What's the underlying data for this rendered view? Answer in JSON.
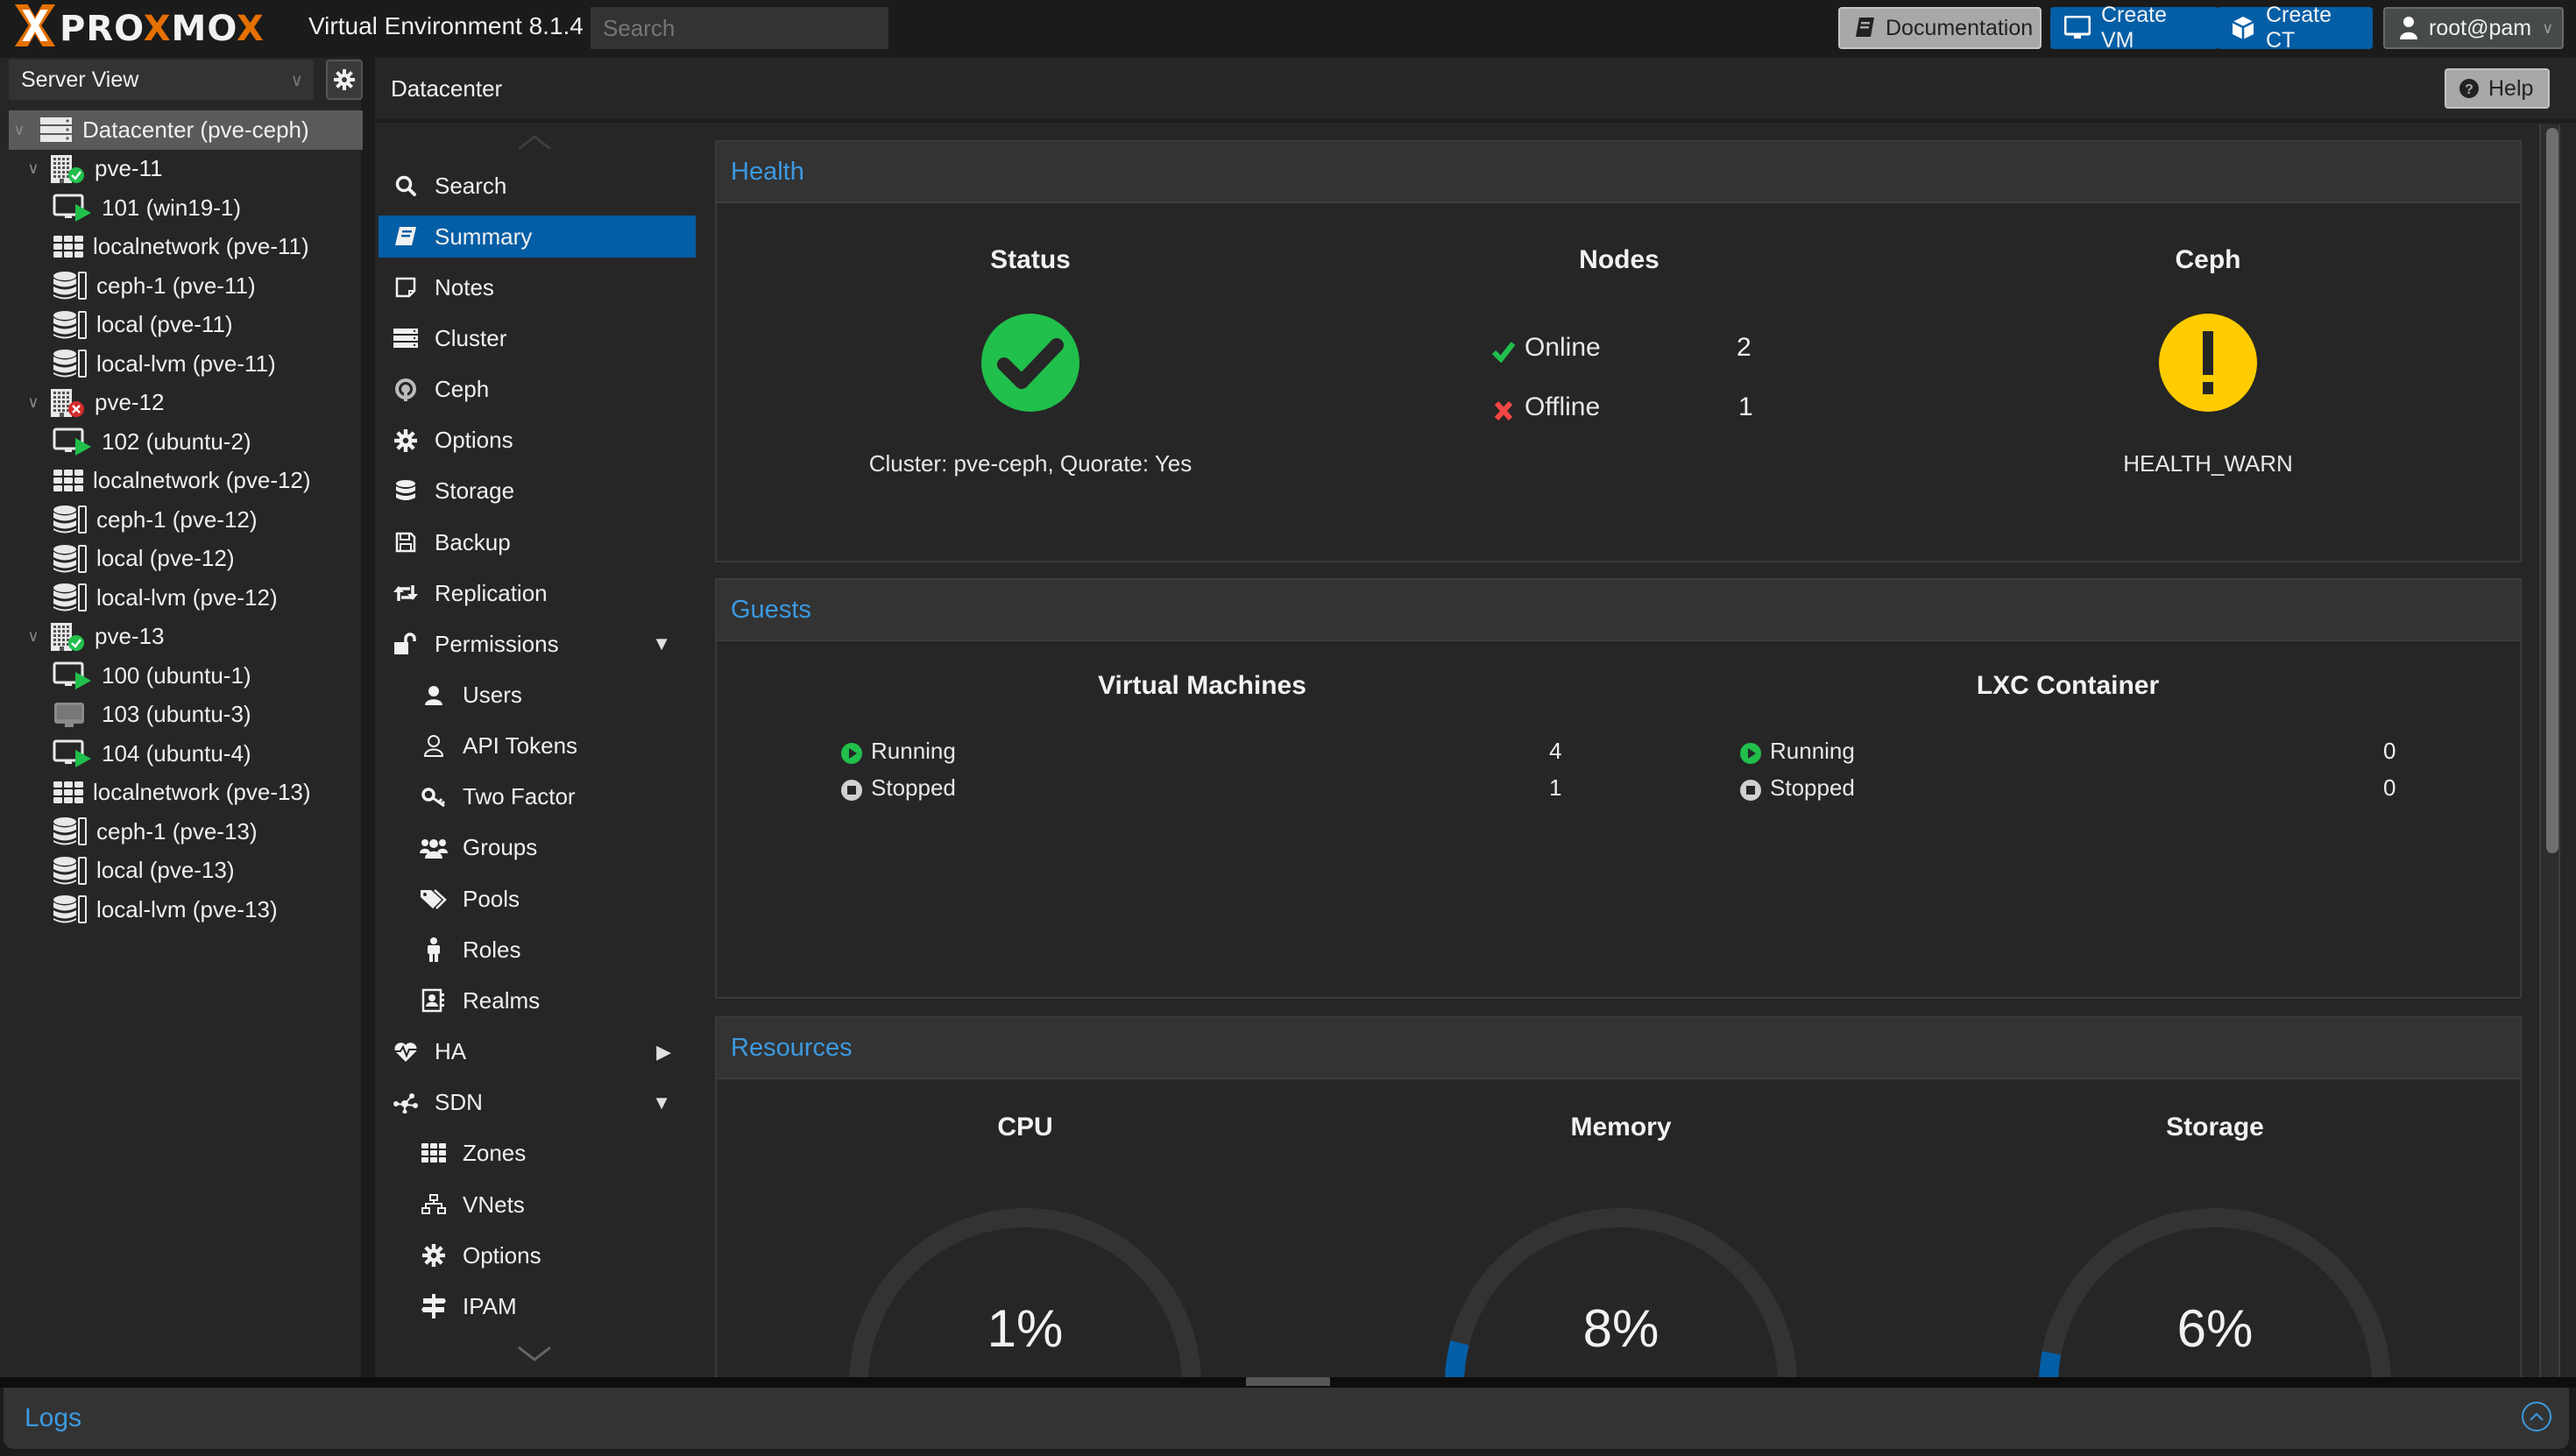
{
  "topbar": {
    "brand": "PROXMOX",
    "product": "Virtual Environment 8.1.4",
    "search_placeholder": "Search",
    "buttons": {
      "documentation": "Documentation",
      "create_vm": "Create VM",
      "create_ct": "Create CT",
      "user": "root@pam"
    }
  },
  "tree": {
    "view": "Server View",
    "nodes": [
      {
        "label": "Datacenter (pve-ceph)",
        "type": "datacenter",
        "level": 0
      },
      {
        "label": "pve-11",
        "type": "node-online",
        "level": 1
      },
      {
        "label": "101 (win19-1)",
        "type": "vm-running",
        "level": 2
      },
      {
        "label": "localnetwork (pve-11)",
        "type": "network",
        "level": 2
      },
      {
        "label": "ceph-1 (pve-11)",
        "type": "storage",
        "level": 2
      },
      {
        "label": "local (pve-11)",
        "type": "storage",
        "level": 2
      },
      {
        "label": "local-lvm (pve-11)",
        "type": "storage",
        "level": 2
      },
      {
        "label": "pve-12",
        "type": "node-offline",
        "level": 1
      },
      {
        "label": "102 (ubuntu-2)",
        "type": "vm-running",
        "level": 2
      },
      {
        "label": "localnetwork (pve-12)",
        "type": "network",
        "level": 2
      },
      {
        "label": "ceph-1 (pve-12)",
        "type": "storage",
        "level": 2
      },
      {
        "label": "local (pve-12)",
        "type": "storage",
        "level": 2
      },
      {
        "label": "local-lvm (pve-12)",
        "type": "storage",
        "level": 2
      },
      {
        "label": "pve-13",
        "type": "node-online",
        "level": 1
      },
      {
        "label": "100 (ubuntu-1)",
        "type": "vm-running",
        "level": 2
      },
      {
        "label": "103 (ubuntu-3)",
        "type": "vm-stopped",
        "level": 2
      },
      {
        "label": "104 (ubuntu-4)",
        "type": "vm-running",
        "level": 2
      },
      {
        "label": "localnetwork (pve-13)",
        "type": "network",
        "level": 2
      },
      {
        "label": "ceph-1 (pve-13)",
        "type": "storage",
        "level": 2
      },
      {
        "label": "local (pve-13)",
        "type": "storage",
        "level": 2
      },
      {
        "label": "local-lvm (pve-13)",
        "type": "storage",
        "level": 2
      }
    ]
  },
  "breadcrumb": "Datacenter",
  "help_label": "Help",
  "nav": {
    "items": [
      {
        "label": "Search",
        "icon": "search-icon",
        "sub": false
      },
      {
        "label": "Summary",
        "icon": "book-icon",
        "sub": false,
        "selected": true
      },
      {
        "label": "Notes",
        "icon": "note-icon",
        "sub": false
      },
      {
        "label": "Cluster",
        "icon": "server-icon",
        "sub": false
      },
      {
        "label": "Ceph",
        "icon": "ceph-icon",
        "sub": false
      },
      {
        "label": "Options",
        "icon": "gear-icon",
        "sub": false
      },
      {
        "label": "Storage",
        "icon": "database-icon",
        "sub": false
      },
      {
        "label": "Backup",
        "icon": "floppy-icon",
        "sub": false
      },
      {
        "label": "Replication",
        "icon": "retweet-icon",
        "sub": false
      },
      {
        "label": "Permissions",
        "icon": "unlock-icon",
        "sub": false,
        "arrow": "down"
      },
      {
        "label": "Users",
        "icon": "user-icon",
        "sub": true
      },
      {
        "label": "API Tokens",
        "icon": "user-outline-icon",
        "sub": true
      },
      {
        "label": "Two Factor",
        "icon": "key-icon",
        "sub": true
      },
      {
        "label": "Groups",
        "icon": "users-icon",
        "sub": true
      },
      {
        "label": "Pools",
        "icon": "tags-icon",
        "sub": true
      },
      {
        "label": "Roles",
        "icon": "male-icon",
        "sub": true
      },
      {
        "label": "Realms",
        "icon": "address-book-icon",
        "sub": true
      },
      {
        "label": "HA",
        "icon": "heartbeat-icon",
        "sub": false,
        "arrow": "right"
      },
      {
        "label": "SDN",
        "icon": "sdn-icon",
        "sub": false,
        "arrow": "down"
      },
      {
        "label": "Zones",
        "icon": "grid-icon",
        "sub": true
      },
      {
        "label": "VNets",
        "icon": "sitemap-icon",
        "sub": true
      },
      {
        "label": "Options",
        "icon": "gear-icon",
        "sub": true
      },
      {
        "label": "IPAM",
        "icon": "signpost-icon",
        "sub": true
      }
    ]
  },
  "health": {
    "title": "Health",
    "status": {
      "title": "Status",
      "text": "Cluster: pve-ceph, Quorate: Yes",
      "state": "ok"
    },
    "nodes": {
      "title": "Nodes",
      "online_label": "Online",
      "online": "2",
      "offline_label": "Offline",
      "offline": "1"
    },
    "ceph": {
      "title": "Ceph",
      "text": "HEALTH_WARN",
      "state": "warn"
    }
  },
  "guests": {
    "title": "Guests",
    "vm": {
      "title": "Virtual Machines",
      "running_label": "Running",
      "running": "4",
      "stopped_label": "Stopped",
      "stopped": "1"
    },
    "lxc": {
      "title": "LXC Container",
      "running_label": "Running",
      "running": "0",
      "stopped_label": "Stopped",
      "stopped": "0"
    }
  },
  "resources": {
    "title": "Resources",
    "gauges": [
      {
        "title": "CPU",
        "value_text": "1%",
        "percent": 1
      },
      {
        "title": "Memory",
        "value_text": "8%",
        "percent": 8
      },
      {
        "title": "Storage",
        "value_text": "6%",
        "percent": 6
      }
    ]
  },
  "logs": {
    "title": "Logs"
  },
  "colors": {
    "accent": "#045ea6",
    "link": "#3b9ae1",
    "brand_orange": "#e57000",
    "ok_green": "#21bf4b",
    "warn_yellow": "#ffcc00",
    "error_red": "#f54646"
  }
}
